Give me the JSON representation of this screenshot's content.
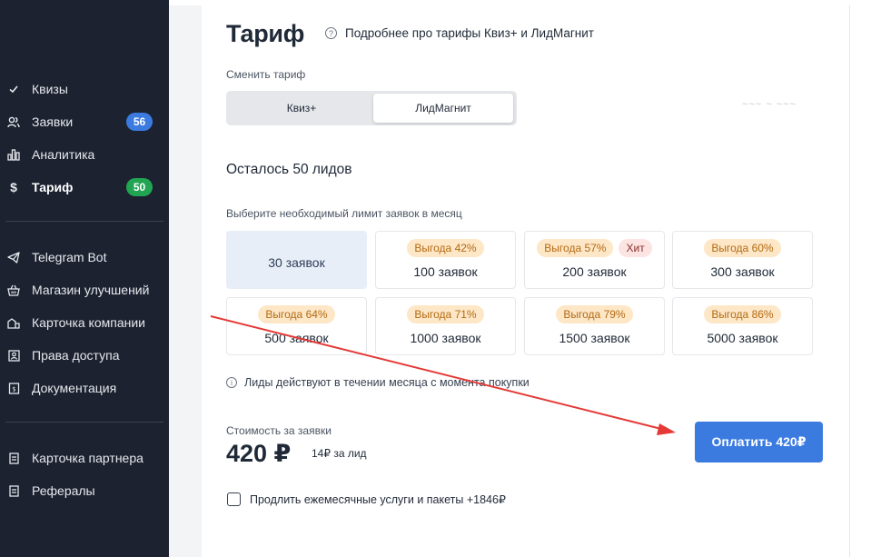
{
  "sidebar": {
    "items": [
      {
        "label": "Квизы",
        "icon": "check-icon",
        "badge": null,
        "active": false
      },
      {
        "label": "Заявки",
        "icon": "users-icon",
        "badge": "56",
        "badge_color": "#3b7be0",
        "active": false
      },
      {
        "label": "Аналитика",
        "icon": "bar-chart-icon",
        "badge": null,
        "active": false
      },
      {
        "label": "Тариф",
        "icon": "dollar-icon",
        "badge": "50",
        "badge_color": "#22a553",
        "active": true
      },
      {
        "label": "Telegram Bot",
        "icon": "telegram-icon",
        "badge": null,
        "active": false
      },
      {
        "label": "Магазин улучшений",
        "icon": "basket-icon",
        "badge": null,
        "active": false
      },
      {
        "label": "Карточка компании",
        "icon": "company-card-icon",
        "badge": null,
        "active": false
      },
      {
        "label": "Права доступа",
        "icon": "access-icon",
        "badge": null,
        "active": false
      },
      {
        "label": "Документация",
        "icon": "document-icon",
        "badge": null,
        "active": false
      },
      {
        "label": "Карточка партнера",
        "icon": "partner-card-icon",
        "badge": null,
        "active": false
      },
      {
        "label": "Рефералы",
        "icon": "referrals-icon",
        "badge": null,
        "active": false
      }
    ]
  },
  "main": {
    "title": "Тариф",
    "info_link": "Подробнее про тарифы Квиз+ и ЛидМагнит",
    "switch_label": "Сменить тариф",
    "tabs": [
      {
        "label": "Квиз+",
        "selected": false
      },
      {
        "label": "ЛидМагнит",
        "selected": true
      }
    ],
    "remaining": "Осталось 50 лидов",
    "limit_label": "Выберите необходимый лимит заявок в месяц",
    "options": [
      {
        "name": "30 заявок",
        "tags": [],
        "selected": true
      },
      {
        "name": "100 заявок",
        "tags": [
          "Выгода 42%"
        ],
        "selected": false
      },
      {
        "name": "200 заявок",
        "tags": [
          "Выгода 57%",
          "Хит"
        ],
        "selected": false
      },
      {
        "name": "300 заявок",
        "tags": [
          "Выгода 60%"
        ],
        "selected": false
      },
      {
        "name": "500 заявок",
        "tags": [
          "Выгода 64%"
        ],
        "selected": false
      },
      {
        "name": "1000 заявок",
        "tags": [
          "Выгода 71%"
        ],
        "selected": false
      },
      {
        "name": "1500 заявок",
        "tags": [
          "Выгода 79%"
        ],
        "selected": false
      },
      {
        "name": "5000 заявок",
        "tags": [
          "Выгода 86%"
        ],
        "selected": false
      }
    ],
    "note": "Лиды действуют в течении месяца с момента покупки",
    "cost_label": "Стоимость за заявки",
    "price": "420 ₽",
    "per_lead": "14₽ за лид",
    "pay_button": "Оплатить 420₽",
    "extend_label": "Продлить ежемесячные услуги и пакеты +1846₽",
    "extend_checked": false
  },
  "colors": {
    "sidebar_bg": "#1c2230",
    "accent": "#3b7be0",
    "badge_green": "#22a553",
    "annotation_arrow": "#e53935"
  }
}
